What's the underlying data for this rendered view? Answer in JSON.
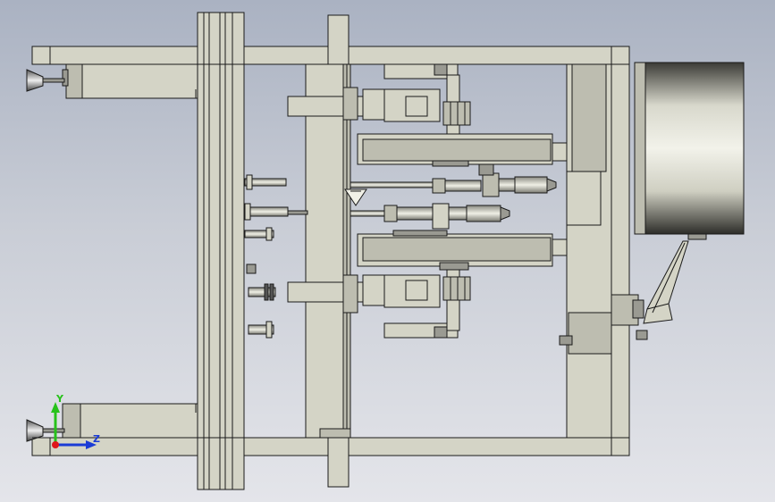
{
  "viewport": {
    "background_top": "#aab2c2",
    "background_bottom": "#e4e5ea"
  },
  "model": {
    "fill": "#d4d4c6",
    "fill_dark": "#bdbdb0",
    "edge": "#1a1a1a",
    "steel": "#9a9a92"
  },
  "triad": {
    "y_label": "Y",
    "z_label": "Z",
    "x_color": "#e0161b",
    "y_color": "#27c21a",
    "z_color": "#1a3bd6"
  }
}
